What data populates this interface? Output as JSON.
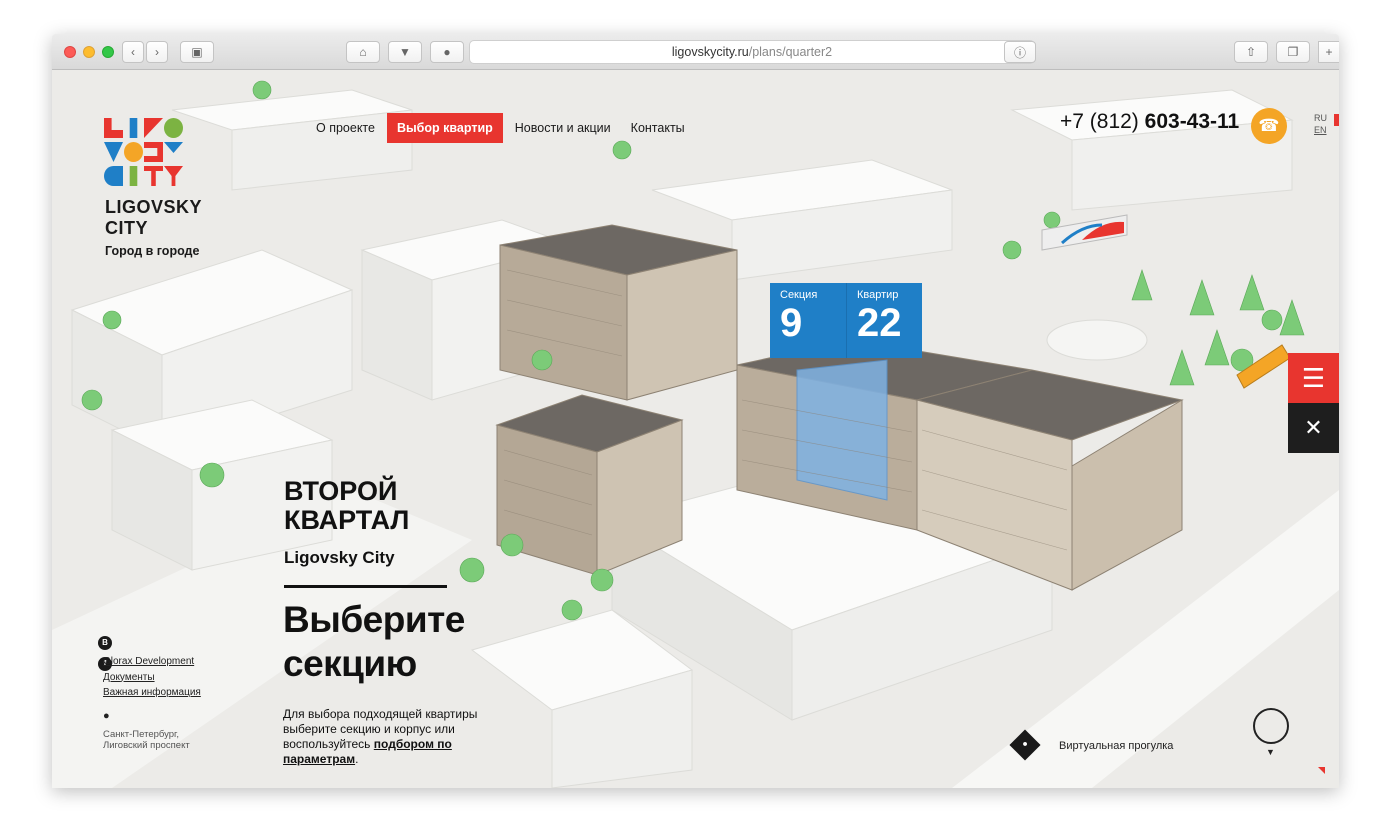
{
  "browser": {
    "url_domain": "ligovskycity.ru",
    "url_path": "/plans/quarter2",
    "tab_plus": "+"
  },
  "brand": {
    "name_line1": "LIGOVSKY",
    "name_line2": "CITY",
    "tagline": "Город в городе"
  },
  "nav": {
    "items": [
      "О проекте",
      "Выбор квартир",
      "Новости и акции",
      "Контакты"
    ],
    "active_index": 1
  },
  "header": {
    "phone_prefix": "+7 (812)",
    "phone_number": "603-43-11",
    "lang_ru": "RU",
    "lang_en": "EN"
  },
  "badges": {
    "section_label": "Секция",
    "section_value": "9",
    "quarter_label": "Квартир",
    "quarter_value": "22"
  },
  "main": {
    "title_line1": "ВТОРОЙ",
    "title_line2": "КВАРТАЛ",
    "subtitle": "Ligovsky City",
    "headline_line1": "Выберите",
    "headline_line2": "секцию",
    "desc_text": "Для выбора подходящей квартиры выберите секцию и корпус или воспользуйтесь",
    "desc_link": "подбором по параметрам",
    "desc_end": "."
  },
  "sidebar": {
    "social_vk": "В",
    "social_fb": "f",
    "links": [
      "Glorax Development",
      "Документы",
      "Важная информация"
    ],
    "address_line1": "Санкт-Петербург,",
    "address_line2": "Лиговский проспект"
  },
  "footer": {
    "virtual_tour": "Виртуальная прогулка"
  },
  "colors": {
    "accent_red": "#e8352f",
    "accent_blue": "#1f7fc7",
    "phone_orange": "#f4a526"
  },
  "icons": [
    "back-icon",
    "forward-icon",
    "sidebar-icon",
    "home-icon",
    "pocket-icon",
    "pin-tab-icon",
    "reload-icon",
    "info-icon",
    "share-icon",
    "tabs-icon",
    "phone-icon",
    "menu-icon",
    "close-icon",
    "map-pin-icon",
    "person-icon",
    "scroll-icon"
  ]
}
